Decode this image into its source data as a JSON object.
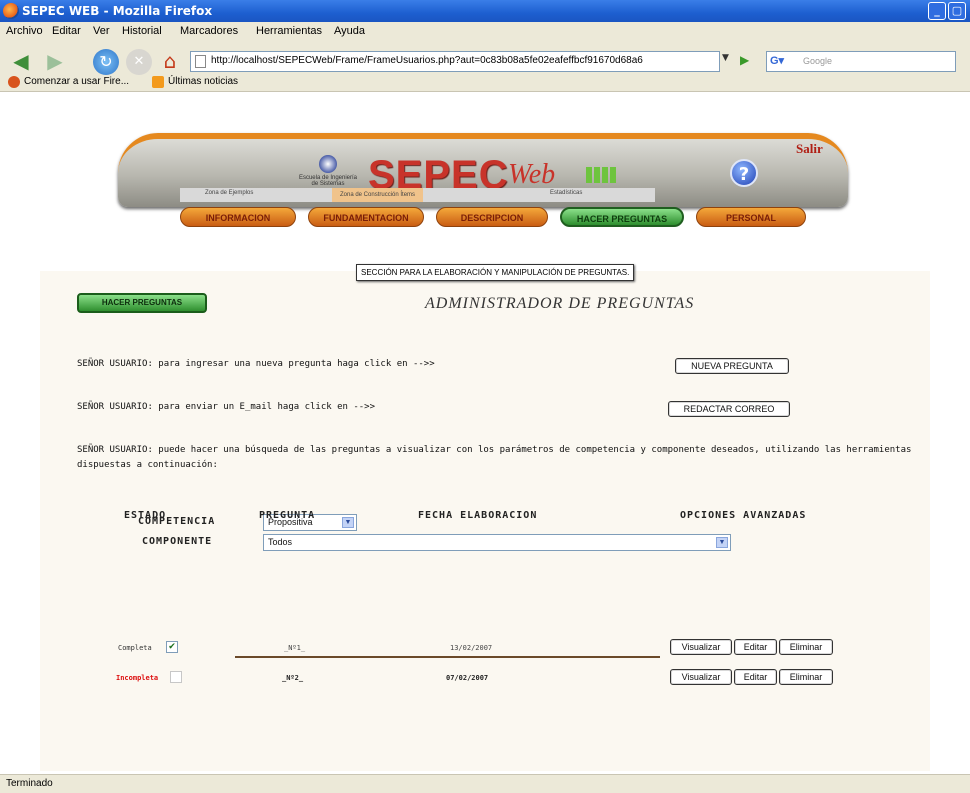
{
  "window": {
    "title": "SEPEC WEB - Mozilla Firefox"
  },
  "menu": [
    "Archivo",
    "Editar",
    "Ver",
    "Historial",
    "Marcadores",
    "Herramientas",
    "Ayuda"
  ],
  "navigation": {
    "url": "http://localhost/SEPECWeb/Frame/FrameUsuarios.php?aut=0c83b08a5fe02eafeffbcf91670d68a6",
    "search_placeholder": "Google"
  },
  "bookmarks": [
    "Comenzar a usar Fire...",
    "Últimas noticias"
  ],
  "banner": {
    "escuela_text": "Escuela de Ingeniería de Sistemas",
    "brand_main": "SEPEC",
    "brand_sub": "Web",
    "salir": "Salir",
    "help": "?"
  },
  "tabs": [
    {
      "label": "INFORMACION",
      "active": false
    },
    {
      "label": "FUNDAMENTACION",
      "active": false
    },
    {
      "label": "DESCRIPCION",
      "active": false
    },
    {
      "label": "HACER PREGUNTAS",
      "active": true
    },
    {
      "label": "PERSONAL",
      "active": false
    }
  ],
  "subtabs": [
    {
      "label": "Zona de Ejemplos",
      "active": false
    },
    {
      "label": "Zona de Construcción Ítems",
      "active": true
    },
    {
      "label": "Estadísticas",
      "active": false
    }
  ],
  "tooltip": "SECCIÓN PARA LA ELABORACIÓN Y MANIPULACIÓN DE PREGUNTAS.",
  "main": {
    "section_badge": "HACER PREGUNTAS",
    "title": "ADMINISTRADOR DE PREGUNTAS",
    "msg_new": "SEÑOR USUARIO: para ingresar una nueva pregunta haga click en -->>",
    "btn_new": "NUEVA PREGUNTA",
    "msg_mail": "SEÑOR USUARIO: para enviar un E_mail  haga click en -->>",
    "btn_mail": "REDACTAR CORREO",
    "msg_search": "SEÑOR USUARIO: puede hacer una búsqueda de las preguntas a visualizar con los parámetros de competencia y componente deseados, utilizando las herramientas dispuestas a continuación:",
    "competencia_label": "COMPETENCIA",
    "competencia_value": "Propositiva",
    "componente_label": "COMPONENTE",
    "componente_value": "Todos"
  },
  "table": {
    "headers": [
      "ESTADO",
      "PREGUNTA",
      "FECHA ELABORACION",
      "OPCIONES AVANZADAS"
    ],
    "rows": [
      {
        "estado": "Completa",
        "checked": true,
        "pregunta": "_Nº1_",
        "fecha": "13/02/2007"
      },
      {
        "estado": "Incompleta",
        "checked": false,
        "pregunta": "_Nº2_",
        "fecha": "07/02/2007"
      }
    ],
    "actions": [
      "Visualizar",
      "Editar",
      "Eliminar"
    ]
  },
  "status": "Terminado"
}
